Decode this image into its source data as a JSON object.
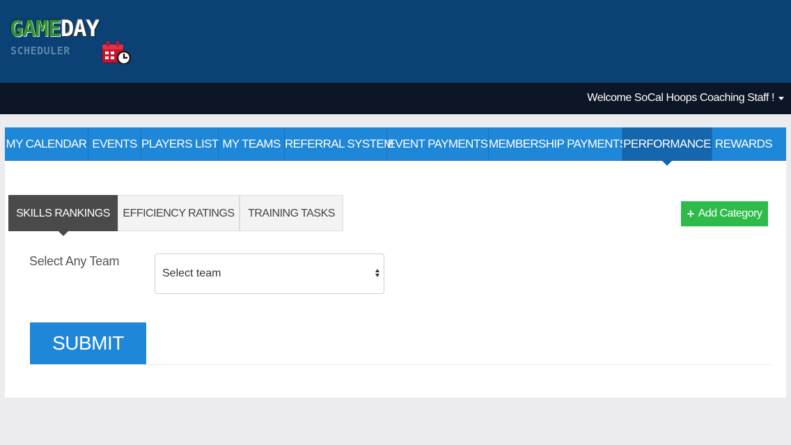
{
  "logo": {
    "word1": "GAME",
    "word2": "DAY",
    "word3": "SCHEDULER"
  },
  "header": {
    "welcome": "Welcome SoCal Hoops Coaching Staff !"
  },
  "nav": {
    "items": [
      {
        "label": "MY CALENDAR"
      },
      {
        "label": "EVENTS"
      },
      {
        "label": "PLAYERS LIST"
      },
      {
        "label": "MY TEAMS"
      },
      {
        "label": "REFERRAL SYSTEM"
      },
      {
        "label": "EVENT PAYMENTS"
      },
      {
        "label": "MEMBERSHIP PAYMENTS"
      },
      {
        "label": "PERFORMANCE",
        "active": true
      },
      {
        "label": "REWARDS"
      }
    ]
  },
  "tabs": [
    {
      "label": "SKILLS RANKINGS",
      "active": true
    },
    {
      "label": "EFFICIENCY RATINGS"
    },
    {
      "label": "TRAINING TASKS"
    }
  ],
  "actions": {
    "add_category": "Add Category"
  },
  "form": {
    "team_label": "Select Any Team",
    "team_select_value": "Select team",
    "submit_label": "SUBMIT"
  },
  "colors": {
    "header_bg": "#0b4174",
    "topbar_bg": "#0c1626",
    "nav_bg": "#1f87d8",
    "nav_active_bg": "#1566ad",
    "tab_active_bg": "#4a4a4a",
    "add_button_bg": "#2ebb4a",
    "submit_bg": "#1f87d8"
  },
  "icons": {
    "logo_calendar": "calendar-clock-icon",
    "user_menu": "caret-down-icon",
    "add": "plus-icon",
    "select": "select-arrows-icon"
  }
}
